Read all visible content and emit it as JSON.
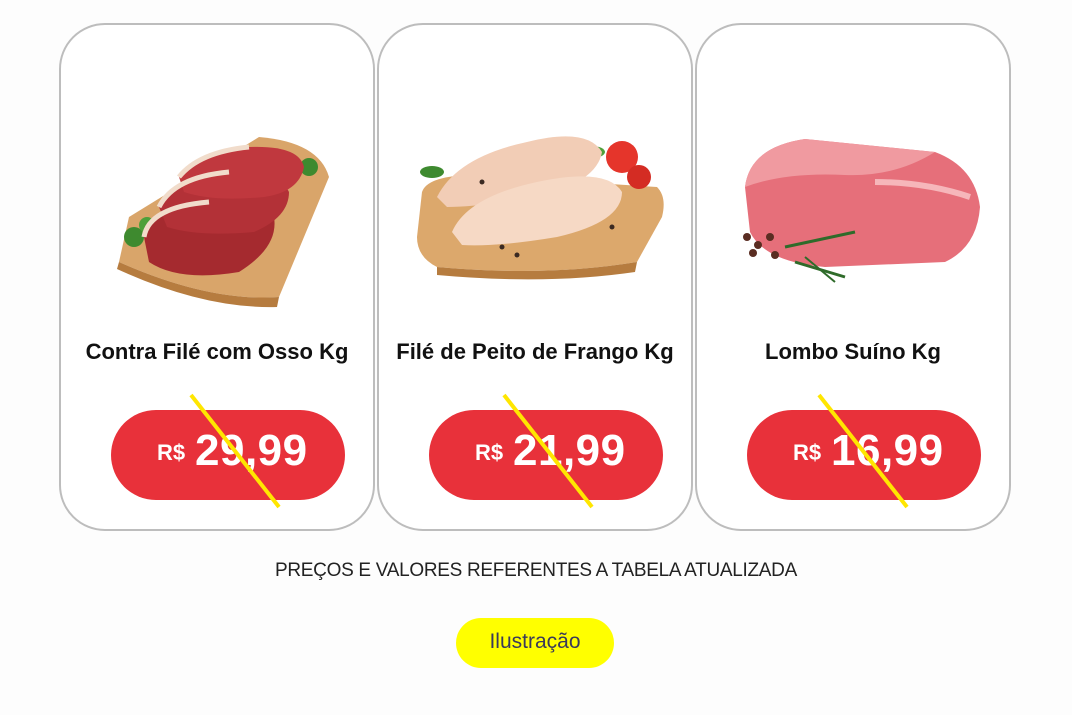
{
  "products": [
    {
      "name": "Contra Filé com Osso Kg",
      "image": "steak-on-board-image",
      "currency": "R$",
      "price": "29,99",
      "price_struck": true
    },
    {
      "name": "Filé de Peito de Frango Kg",
      "image": "chicken-breast-on-board-image",
      "currency": "R$",
      "price": "21,99",
      "price_struck": true
    },
    {
      "name": "Lombo Suíno Kg",
      "image": "pork-loin-image",
      "currency": "R$",
      "price": "16,99",
      "price_struck": true
    }
  ],
  "notice": "PREÇOS E VALORES REFERENTES A TABELA ATUALIZADA",
  "badge": "Ilustração",
  "colors": {
    "price_pill": "#e8313a",
    "strike_line": "#ffe600",
    "badge": "#ffff00",
    "card_border": "#bdbdbd"
  }
}
